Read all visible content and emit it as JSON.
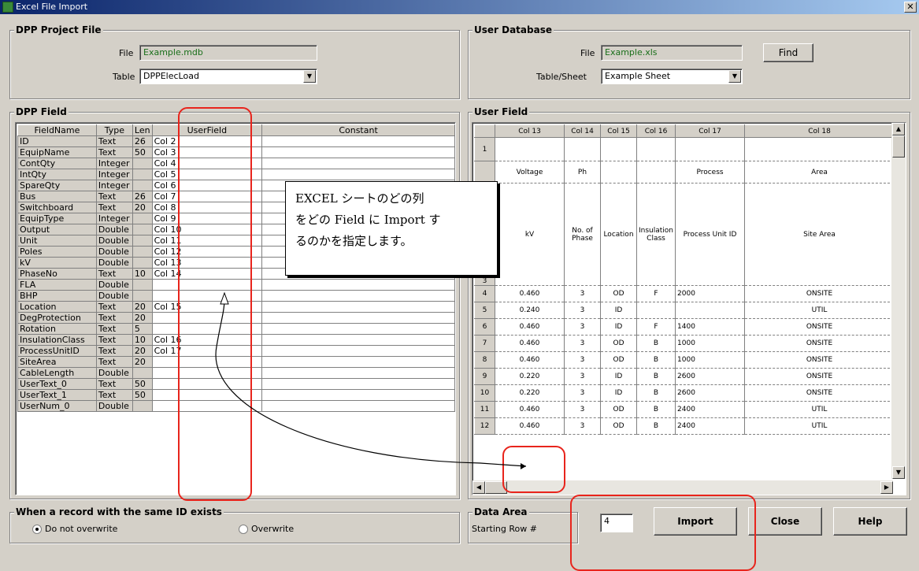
{
  "window": {
    "title": "Excel File Import",
    "close_glyph": "✕"
  },
  "dpp_project": {
    "title": "DPP Project File",
    "file_label": "File",
    "file_value": "Example.mdb",
    "table_label": "Table",
    "table_value": "DPPElecLoad"
  },
  "user_database": {
    "title": "User Database",
    "file_label": "File",
    "file_value": "Example.xls",
    "find_label": "Find",
    "sheet_label": "Table/Sheet",
    "sheet_value": "Example Sheet"
  },
  "dpp_field": {
    "title": "DPP Field",
    "headers": [
      "FieldName",
      "Type",
      "Len",
      "UserField",
      "Constant"
    ],
    "rows": [
      [
        "ID",
        "Text",
        "26",
        "Col 2",
        ""
      ],
      [
        "EquipName",
        "Text",
        "50",
        "Col 3",
        ""
      ],
      [
        "ContQty",
        "Integer",
        "",
        "Col 4",
        ""
      ],
      [
        "IntQty",
        "Integer",
        "",
        "Col 5",
        ""
      ],
      [
        "SpareQty",
        "Integer",
        "",
        "Col 6",
        ""
      ],
      [
        "Bus",
        "Text",
        "26",
        "Col 7",
        ""
      ],
      [
        "Switchboard",
        "Text",
        "20",
        "Col 8",
        ""
      ],
      [
        "EquipType",
        "Integer",
        "",
        "Col 9",
        ""
      ],
      [
        "Output",
        "Double",
        "",
        "Col 10",
        ""
      ],
      [
        "Unit",
        "Double",
        "",
        "Col 11",
        ""
      ],
      [
        "Poles",
        "Double",
        "",
        "Col 12",
        ""
      ],
      [
        "kV",
        "Double",
        "",
        "Col 13",
        ""
      ],
      [
        "PhaseNo",
        "Text",
        "10",
        "Col 14",
        ""
      ],
      [
        "FLA",
        "Double",
        "",
        "",
        ""
      ],
      [
        "BHP",
        "Double",
        "",
        "",
        ""
      ],
      [
        "Location",
        "Text",
        "20",
        "Col 15",
        ""
      ],
      [
        "DegProtection",
        "Text",
        "20",
        "",
        ""
      ],
      [
        "Rotation",
        "Text",
        "5",
        "",
        ""
      ],
      [
        "InsulationClass",
        "Text",
        "10",
        "Col 16",
        ""
      ],
      [
        "ProcessUnitID",
        "Text",
        "20",
        "Col 17",
        ""
      ],
      [
        "SiteArea",
        "Text",
        "20",
        "",
        ""
      ],
      [
        "CableLength",
        "Double",
        "",
        "",
        ""
      ],
      [
        "UserText_0",
        "Text",
        "50",
        "",
        ""
      ],
      [
        "UserText_1",
        "Text",
        "50",
        "",
        ""
      ],
      [
        "UserNum_0",
        "Double",
        "",
        "",
        ""
      ]
    ]
  },
  "user_field": {
    "title": "User Field",
    "headers": [
      "",
      "Col 13",
      "Col 14",
      "Col 15",
      "Col 16",
      "Col 17",
      "Col 18"
    ],
    "header_rows": [
      [
        "1",
        "",
        "",
        "",
        "",
        "",
        ""
      ],
      [
        "",
        "Voltage",
        "Ph",
        "",
        "",
        "Process",
        "Area"
      ],
      [
        "3",
        "kV",
        "No. of Phase",
        "Location",
        "Insulation Class",
        "Process Unit ID",
        "Site Area"
      ]
    ],
    "rows": [
      [
        "4",
        "0.460",
        "3",
        "OD",
        "F",
        "2000",
        "ONSITE"
      ],
      [
        "5",
        "0.240",
        "3",
        "ID",
        "",
        "",
        "UTIL"
      ],
      [
        "6",
        "0.460",
        "3",
        "ID",
        "F",
        "1400",
        "ONSITE"
      ],
      [
        "7",
        "0.460",
        "3",
        "OD",
        "B",
        "1000",
        "ONSITE"
      ],
      [
        "8",
        "0.460",
        "3",
        "OD",
        "B",
        "1000",
        "ONSITE"
      ],
      [
        "9",
        "0.220",
        "3",
        "ID",
        "B",
        "2600",
        "ONSITE"
      ],
      [
        "10",
        "0.220",
        "3",
        "ID",
        "B",
        "2600",
        "ONSITE"
      ],
      [
        "11",
        "0.460",
        "3",
        "OD",
        "B",
        "2400",
        "UTIL"
      ],
      [
        "12",
        "0.460",
        "3",
        "OD",
        "B",
        "2400",
        "UTIL"
      ]
    ]
  },
  "callout": {
    "text": "EXCEL シートのどの列\nをどの Field に Import す\nるのかを指定します。"
  },
  "record_options": {
    "title": "When a record with the same ID exists",
    "options": [
      "Do not overwrite",
      "Overwrite"
    ],
    "selected": "Do not overwrite"
  },
  "data_area": {
    "title": "Data Area",
    "start_label": "Starting Row #",
    "start_value": "4"
  },
  "buttons": {
    "import": "Import",
    "close": "Close",
    "help": "Help"
  },
  "colors": {
    "highlight": "#e8241c",
    "title_start": "#0a246a",
    "title_end": "#a6caf0",
    "file_text": "#1a6f1a"
  }
}
